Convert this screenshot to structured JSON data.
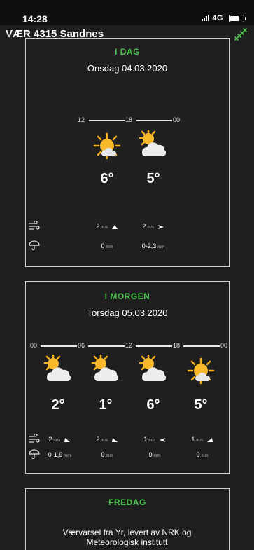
{
  "status": {
    "time": "14:28",
    "network": "4G"
  },
  "app": {
    "title": "VÆR 4315 Sandnes"
  },
  "cards": [
    {
      "day": "I DAG",
      "date": "Onsdag 04.03.2020",
      "timeline": [
        "12",
        "18",
        "00"
      ],
      "periods": [
        {
          "icon": "sun-cloud-icon",
          "temp": "6°",
          "wind": "2",
          "wind_unit": "m/s",
          "precip": "0",
          "precip_unit": "mm"
        },
        {
          "icon": "cloud-sun-icon",
          "temp": "5°",
          "wind": "2",
          "wind_unit": "m/s",
          "precip": "0-2,3",
          "precip_unit": "mm"
        }
      ]
    },
    {
      "day": "I MORGEN",
      "date": "Torsdag 05.03.2020",
      "timeline": [
        "00",
        "06",
        "12",
        "18",
        "00"
      ],
      "periods": [
        {
          "icon": "cloud-sun-icon",
          "temp": "2°",
          "wind": "2",
          "wind_unit": "m/s",
          "precip": "0-1,9",
          "precip_unit": "mm"
        },
        {
          "icon": "cloud-sun-icon",
          "temp": "1°",
          "wind": "2",
          "wind_unit": "m/s",
          "precip": "0",
          "precip_unit": "mm"
        },
        {
          "icon": "cloud-sun-icon",
          "temp": "6°",
          "wind": "1",
          "wind_unit": "m/s",
          "precip": "0",
          "precip_unit": "mm"
        },
        {
          "icon": "sun-cloud-icon",
          "temp": "5°",
          "wind": "1",
          "wind_unit": "m/s",
          "precip": "0",
          "precip_unit": "mm"
        }
      ]
    },
    {
      "day": "FREDAG"
    }
  ],
  "footer": {
    "line1": "Værvarsel fra Yr, levert av NRK og",
    "line2": "Meteorologisk institutt"
  },
  "colors": {
    "accent": "#4cc14f",
    "background": "#1f1f1f",
    "border": "#cfcfcf",
    "sun": "#f5b21d"
  }
}
